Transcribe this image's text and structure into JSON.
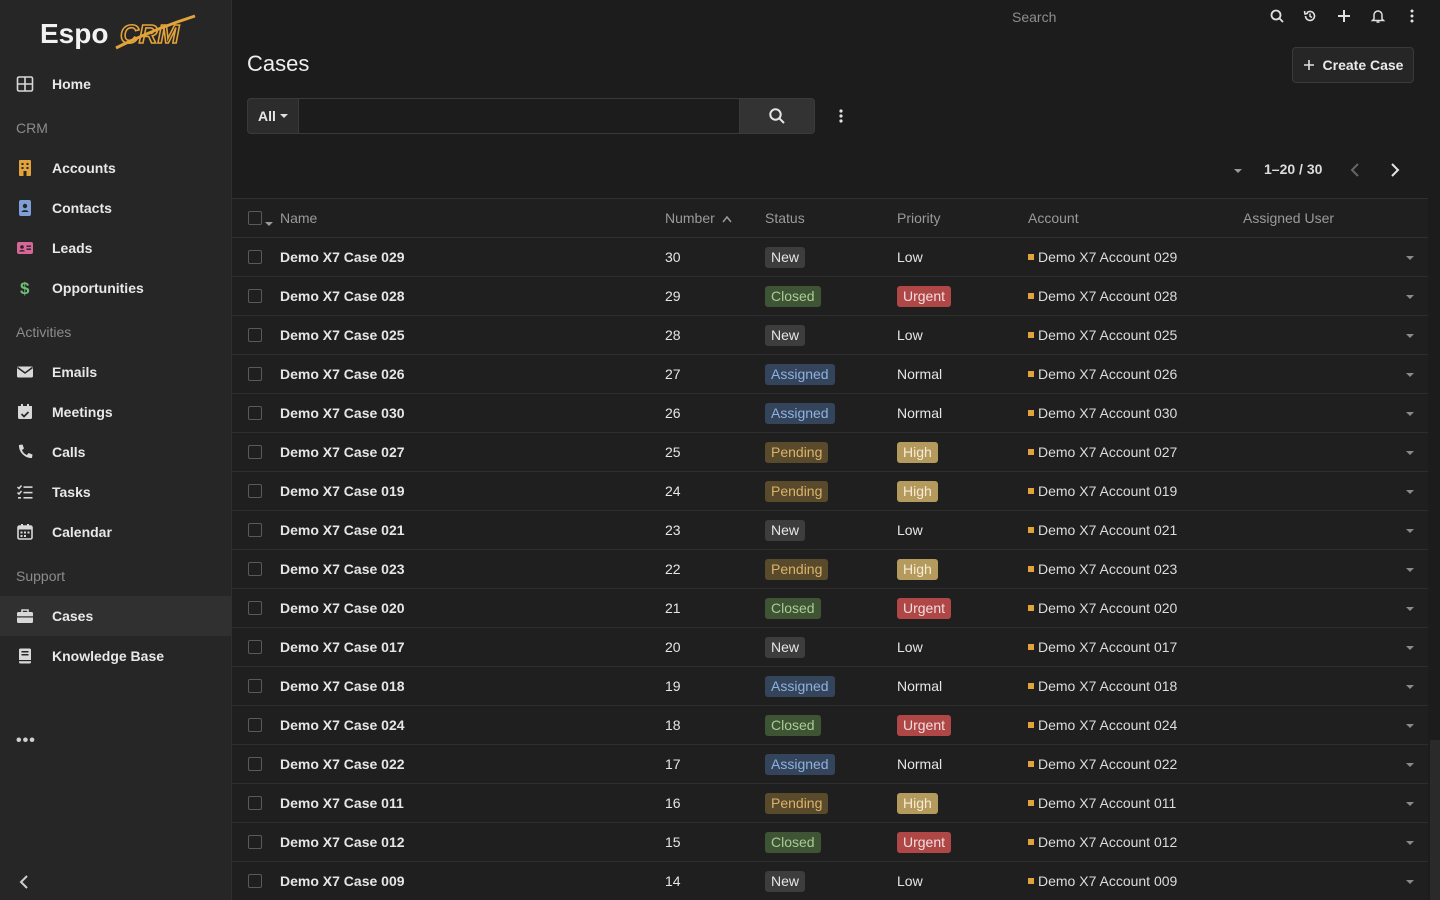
{
  "app": {
    "logo_text": "EspoCRM"
  },
  "sidebar": {
    "items": [
      {
        "label": "Home",
        "icon": "home-grid-icon"
      },
      {
        "group": "CRM"
      },
      {
        "label": "Accounts",
        "icon": "building-icon",
        "color": "#e2a33a"
      },
      {
        "label": "Contacts",
        "icon": "contact-card-icon",
        "color": "#7f9fd9"
      },
      {
        "label": "Leads",
        "icon": "id-card-icon",
        "color": "#d9669b"
      },
      {
        "label": "Opportunities",
        "icon": "dollar-icon",
        "color": "#6fbf73"
      },
      {
        "group": "Activities"
      },
      {
        "label": "Emails",
        "icon": "envelope-icon"
      },
      {
        "label": "Meetings",
        "icon": "calendar-check-icon"
      },
      {
        "label": "Calls",
        "icon": "phone-icon"
      },
      {
        "label": "Tasks",
        "icon": "task-list-icon"
      },
      {
        "label": "Calendar",
        "icon": "calendar-icon"
      },
      {
        "group": "Support"
      },
      {
        "label": "Cases",
        "icon": "briefcase-icon",
        "active": true
      },
      {
        "label": "Knowledge Base",
        "icon": "book-icon"
      }
    ],
    "more": "•••"
  },
  "topbar": {
    "search_placeholder": "Search"
  },
  "header": {
    "title": "Cases",
    "create_label": "Create Case"
  },
  "filter": {
    "scope": "All",
    "value": ""
  },
  "pagination": {
    "text": "1–20 / 30"
  },
  "table": {
    "headers": [
      "Name",
      "Number",
      "Status",
      "Priority",
      "Account",
      "Assigned User"
    ],
    "rows": [
      {
        "name": "Demo X7 Case 029",
        "number": "30",
        "status": "New",
        "priority": "Low",
        "account": "Demo X7 Account 029"
      },
      {
        "name": "Demo X7 Case 028",
        "number": "29",
        "status": "Closed",
        "priority": "Urgent",
        "account": "Demo X7 Account 028"
      },
      {
        "name": "Demo X7 Case 025",
        "number": "28",
        "status": "New",
        "priority": "Low",
        "account": "Demo X7 Account 025"
      },
      {
        "name": "Demo X7 Case 026",
        "number": "27",
        "status": "Assigned",
        "priority": "Normal",
        "account": "Demo X7 Account 026"
      },
      {
        "name": "Demo X7 Case 030",
        "number": "26",
        "status": "Assigned",
        "priority": "Normal",
        "account": "Demo X7 Account 030"
      },
      {
        "name": "Demo X7 Case 027",
        "number": "25",
        "status": "Pending",
        "priority": "High",
        "account": "Demo X7 Account 027"
      },
      {
        "name": "Demo X7 Case 019",
        "number": "24",
        "status": "Pending",
        "priority": "High",
        "account": "Demo X7 Account 019"
      },
      {
        "name": "Demo X7 Case 021",
        "number": "23",
        "status": "New",
        "priority": "Low",
        "account": "Demo X7 Account 021"
      },
      {
        "name": "Demo X7 Case 023",
        "number": "22",
        "status": "Pending",
        "priority": "High",
        "account": "Demo X7 Account 023"
      },
      {
        "name": "Demo X7 Case 020",
        "number": "21",
        "status": "Closed",
        "priority": "Urgent",
        "account": "Demo X7 Account 020"
      },
      {
        "name": "Demo X7 Case 017",
        "number": "20",
        "status": "New",
        "priority": "Low",
        "account": "Demo X7 Account 017"
      },
      {
        "name": "Demo X7 Case 018",
        "number": "19",
        "status": "Assigned",
        "priority": "Normal",
        "account": "Demo X7 Account 018"
      },
      {
        "name": "Demo X7 Case 024",
        "number": "18",
        "status": "Closed",
        "priority": "Urgent",
        "account": "Demo X7 Account 024"
      },
      {
        "name": "Demo X7 Case 022",
        "number": "17",
        "status": "Assigned",
        "priority": "Normal",
        "account": "Demo X7 Account 022"
      },
      {
        "name": "Demo X7 Case 011",
        "number": "16",
        "status": "Pending",
        "priority": "High",
        "account": "Demo X7 Account 011"
      },
      {
        "name": "Demo X7 Case 012",
        "number": "15",
        "status": "Closed",
        "priority": "Urgent",
        "account": "Demo X7 Account 012"
      },
      {
        "name": "Demo X7 Case 009",
        "number": "14",
        "status": "New",
        "priority": "Low",
        "account": "Demo X7 Account 009"
      }
    ]
  }
}
